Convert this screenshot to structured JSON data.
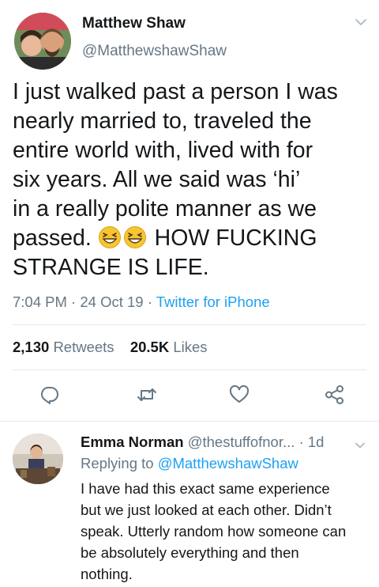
{
  "tweet": {
    "author_name": "Matthew Shaw",
    "author_handle": "@MatthewshawShaw",
    "text_lines": [
      "I just walked past a person I was",
      "nearly married to, traveled the",
      "entire world with, lived with for",
      "six years. All we said was ‘hi’",
      "in a really polite manner as we",
      "passed.",
      "HOW FUCKING",
      "STRANGE IS LIFE."
    ],
    "emojis": [
      "grinning-squinting-face-icon",
      "grinning-squinting-face-icon"
    ],
    "time": "7:04 PM",
    "date": "24 Oct 19",
    "separator": "·",
    "source": "Twitter for iPhone",
    "retweets_count": "2,130",
    "retweets_label": "Retweets",
    "likes_count": "20.5K",
    "likes_label": "Likes"
  },
  "actions": [
    "reply-icon",
    "retweet-icon",
    "heart-icon",
    "share-icon"
  ],
  "reply": {
    "author_name": "Emma Norman",
    "author_handle": "@thestuffofnor...",
    "time": "1d",
    "separator": "·",
    "replying_to_label": "Replying to",
    "replying_to_handle": "@MatthewshawShaw",
    "text_lines": [
      "I have had this exact same experience",
      "but we just looked at each other. Didn’t",
      "speak. Utterly random how someone can",
      "be absolutely everything and then",
      "nothing."
    ]
  },
  "colors": {
    "text": "#14171a",
    "secondary": "#657786",
    "accent": "#1da1f2",
    "divider": "#e1e8ed",
    "emoji": "#f7c531"
  }
}
